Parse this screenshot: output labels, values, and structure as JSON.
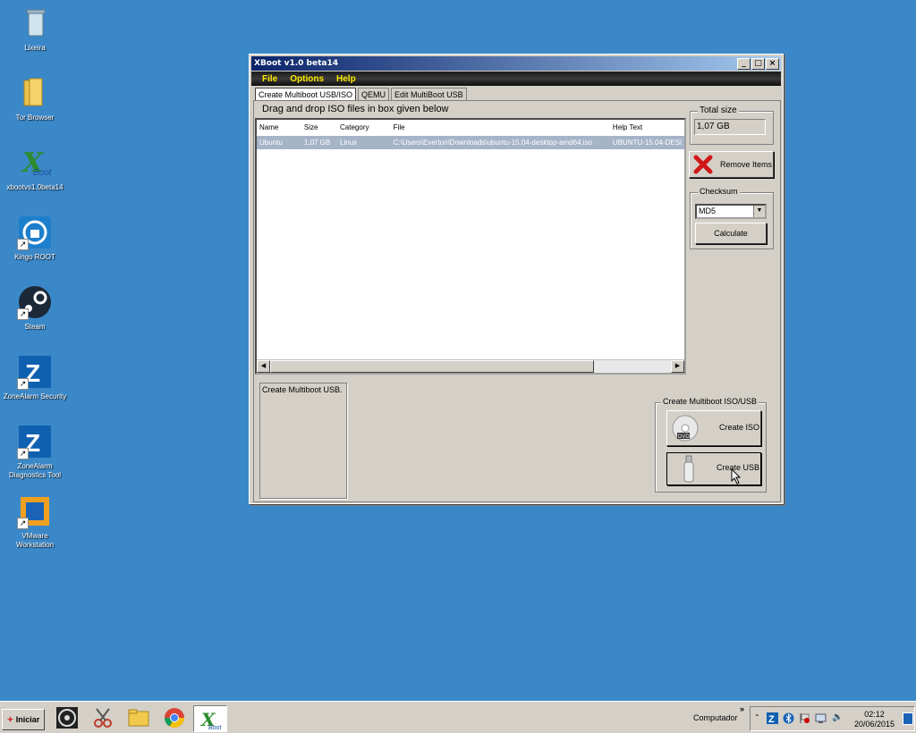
{
  "desktop": {
    "icons": [
      {
        "label": "Lixeira"
      },
      {
        "label": "Tor Browser"
      },
      {
        "label": "xbootvs1.0beta14"
      },
      {
        "label": "Kingo ROOT"
      },
      {
        "label": "Steam"
      },
      {
        "label": "ZoneAlarm Security"
      },
      {
        "label": "ZoneAlarm Diagnostics Tool"
      },
      {
        "label": "VMware Workstation"
      }
    ]
  },
  "window": {
    "title": "XBoot v1.0 beta14",
    "menu": [
      "File",
      "Options",
      "Help"
    ],
    "tabs": [
      "Create Multiboot USB/ISO",
      "QEMU",
      "Edit MultiBoot USB"
    ],
    "drag_hint": "Drag and drop ISO files in box given below",
    "list": {
      "columns": [
        "Name",
        "Size",
        "Category",
        "File",
        "Help Text"
      ],
      "rows": [
        {
          "name": "Ubuntu",
          "size": "1,07 GB",
          "category": "Linux",
          "file": "C:\\Users\\Everton\\Downloads\\ubuntu-15.04-desktop-amd64.iso",
          "help": "UBUNTU-15.04-DESI"
        }
      ]
    },
    "total_size": {
      "legend": "Total size",
      "value": "1,07 GB"
    },
    "remove_label": "Remove Items",
    "checksum": {
      "legend": "Checksum",
      "selected": "MD5",
      "calculate_label": "Calculate"
    },
    "status_text": "Create Multiboot USB.",
    "create_group": {
      "legend": "Create Multiboot ISO/USB",
      "iso_label": "Create ISO",
      "usb_label": "Create USB"
    }
  },
  "taskbar": {
    "start_label": "Iniciar",
    "computer_label": "Computador",
    "time": "02:12",
    "date": "20/06/2015"
  },
  "colors": {
    "desktop": "#3b88c9",
    "menu_text": "#ffea00",
    "selection": "#a6b4c8"
  }
}
